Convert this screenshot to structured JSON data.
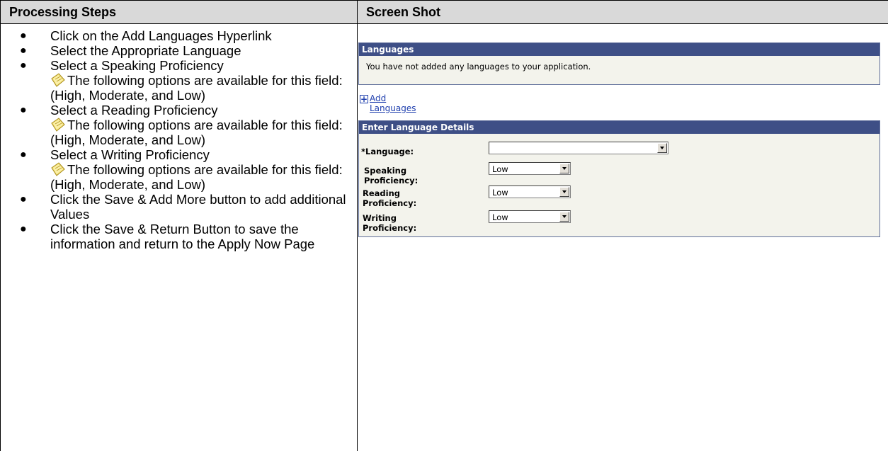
{
  "table": {
    "col_left_header": "Processing Steps",
    "col_right_header": "Screen Shot"
  },
  "steps": [
    {
      "text": "Click on the Add Languages Hyperlink"
    },
    {
      "text": "Select the Appropriate Language"
    },
    {
      "text": "Select a Speaking Proficiency",
      "note": "The following options are available for this field: (High, Moderate, and Low)"
    },
    {
      "text": "Select a Reading Proficiency",
      "note": "The following options are available for this field: (High, Moderate, and Low)"
    },
    {
      "text": "Select a Writing Proficiency",
      "note": "The following options are available for this field: (High, Moderate, and Low)"
    },
    {
      "text": "Click the Save & Add More button to add additional Values"
    },
    {
      "text": "Click the Save & Return Button to save the information and return to the Apply Now Page"
    }
  ],
  "screenshot": {
    "languages_panel": {
      "title": "Languages",
      "message": "You have not added any languages to your application."
    },
    "add_link": "Add Languages",
    "details_panel": {
      "title": "Enter Language Details",
      "fields": {
        "language": {
          "label": "*Language:",
          "value": ""
        },
        "speaking": {
          "label": "Speaking Proficiency:",
          "value": "Low"
        },
        "reading": {
          "label": "Reading Proficiency:",
          "value": "Low"
        },
        "writing": {
          "label": "Writing Proficiency:",
          "value": "Low"
        }
      }
    },
    "colors": {
      "panel_header": "#3e4f86",
      "panel_bg": "#f3f3ec",
      "link": "#1f3fae"
    }
  }
}
